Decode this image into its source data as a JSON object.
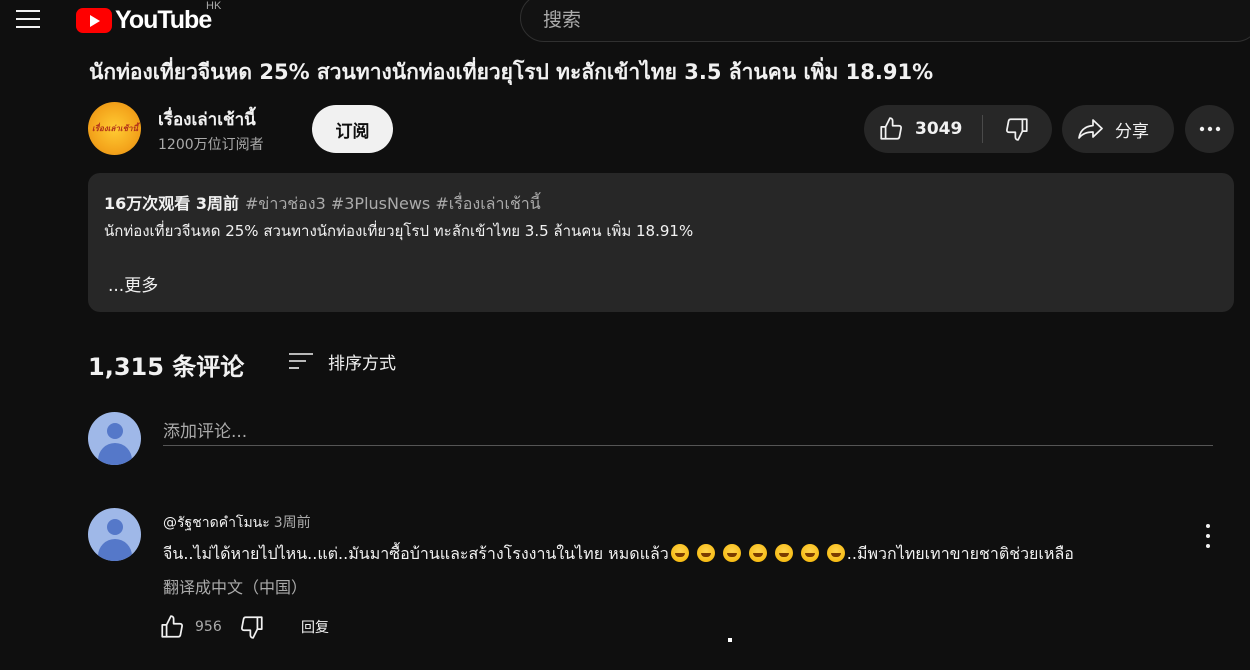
{
  "header": {
    "logo_text": "YouTube",
    "country_code": "HK",
    "search_placeholder": "搜索"
  },
  "video": {
    "title": "นักท่องเที่ยวจีนหด 25% สวนทางนักท่องเที่ยวยุโรป ทะลักเข้าไทย 3.5 ล้านคน เพิ่ม 18.91%",
    "channel_name": "เรื่องเล่าเช้านี้",
    "channel_logo_text": "เรื่องเล่าเช้านี้",
    "subscribers": "1200万位订阅者",
    "subscribe_label": "订阅",
    "like_count": "3049",
    "share_label": "分享"
  },
  "description": {
    "views_time": "16万次观看  3周前",
    "hashtags": "#ข่าวช่อง3 #3PlusNews #เรื่องเล่าเช้านี้",
    "text": "นักท่องเที่ยวจีนหด 25% สวนทางนักท่องเที่ยวยุโรป ทะลักเข้าไทย 3.5 ล้านคน เพิ่ม 18.91%",
    "more_label": "...更多"
  },
  "comments": {
    "count_label": "1,315 条评论",
    "sort_label": "排序方式",
    "add_placeholder": "添加评论...",
    "items": [
      {
        "author": "@รัฐชาดคำโมนะ",
        "time": "3周前",
        "text_start": "จีน..ไม่ได้หายไปไหน..แต่..มันมาซื้อบ้านและสร้างโรงงานในไทย หมดแล้ว",
        "text_end": "..มีพวกไทยเทาขายชาติช่วยเหลือ",
        "translate_label": "翻译成中文（中国）",
        "like_count": "956",
        "reply_label": "回复"
      }
    ]
  },
  "colors": {
    "background": "#0f0f0f",
    "surface": "#272727",
    "brand_red": "#ff0000",
    "text_primary": "#f1f1f1",
    "text_secondary": "#aaaaaa",
    "avatar_blue": "#5578c9"
  }
}
